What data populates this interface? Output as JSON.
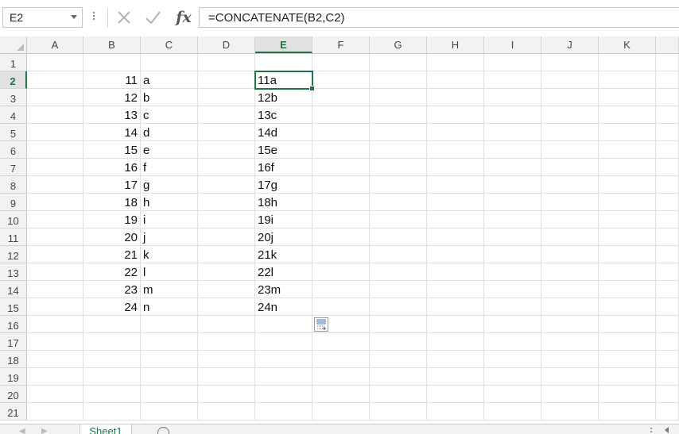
{
  "formula_bar": {
    "name_box": "E2",
    "formula": "=CONCATENATE(B2,C2)",
    "fx_label": "fx",
    "cancel_icon": "x-icon",
    "enter_icon": "check-icon"
  },
  "columns": [
    "A",
    "B",
    "C",
    "D",
    "E",
    "F",
    "G",
    "H",
    "I",
    "J",
    "K"
  ],
  "selected_column": "E",
  "rows": [
    "1",
    "2",
    "3",
    "4",
    "5",
    "6",
    "7",
    "8",
    "9",
    "10",
    "11",
    "12",
    "13",
    "14",
    "15",
    "16",
    "17",
    "18",
    "19",
    "20",
    "21"
  ],
  "selected_row": "2",
  "cells": {
    "B": [
      "11",
      "12",
      "13",
      "14",
      "15",
      "16",
      "17",
      "18",
      "19",
      "20",
      "21",
      "22",
      "23",
      "24"
    ],
    "C": [
      "a",
      "b",
      "c",
      "d",
      "e",
      "f",
      "g",
      "h",
      "i",
      "j",
      "k",
      "l",
      "m",
      "n"
    ],
    "E": [
      "11a",
      "12b",
      "13c",
      "14d",
      "15e",
      "16f",
      "17g",
      "18h",
      "19i",
      "20j",
      "21k",
      "22l",
      "23m",
      "24n"
    ]
  },
  "sheet_tabs": [
    "Sheet1"
  ],
  "colors": {
    "accent": "#217346",
    "header_bg": "#f2f2f2",
    "gridline": "#e0e0e0"
  }
}
